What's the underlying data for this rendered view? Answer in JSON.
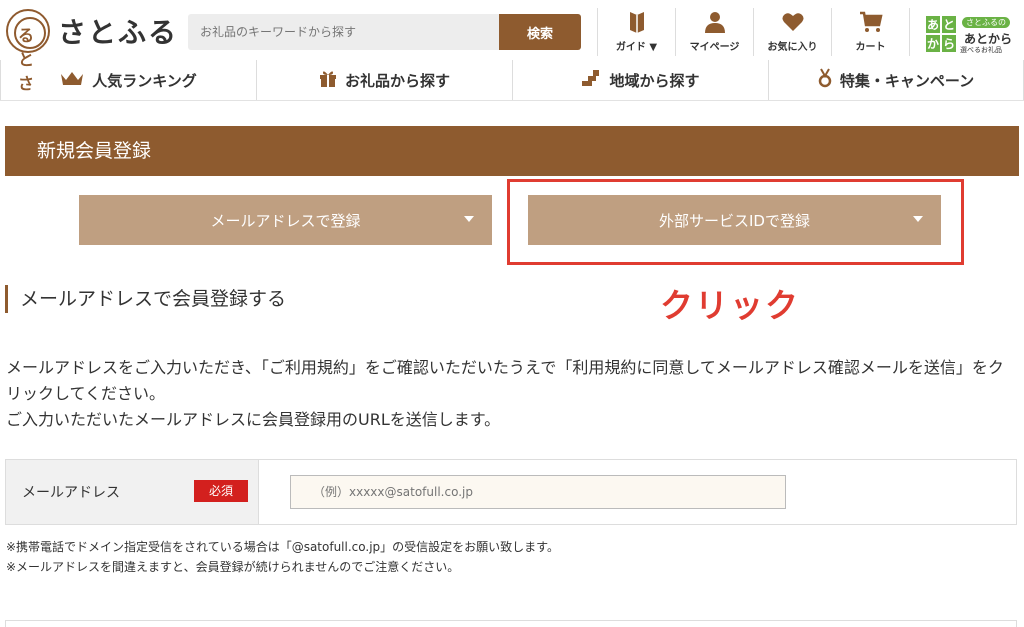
{
  "header": {
    "logo_mark": "るとさ",
    "logo_text": "さとふる",
    "search_placeholder": "お礼品のキーワードから探す",
    "search_button": "検索",
    "util": [
      {
        "label": "ガイド ▼",
        "icon": "book-icon"
      },
      {
        "label": "マイページ",
        "icon": "user-icon"
      },
      {
        "label": "お気に入り",
        "icon": "heart-icon"
      },
      {
        "label": "カート",
        "icon": "cart-icon"
      }
    ],
    "atokara": {
      "grid": [
        "あ",
        "と",
        "か",
        "ら"
      ],
      "badge": "さとふるの",
      "title": "あとから",
      "sub": "選べるお礼品"
    }
  },
  "nav": [
    {
      "label": "人気ランキング",
      "icon": "crown-icon"
    },
    {
      "label": "お礼品から探す",
      "icon": "gift-icon"
    },
    {
      "label": "地域から探す",
      "icon": "map-icon"
    },
    {
      "label": "特集・キャンペーン",
      "icon": "medal-icon"
    }
  ],
  "page_title": "新規会員登録",
  "tabs": {
    "email": "メールアドレスで登録",
    "external": "外部サービスIDで登録"
  },
  "annotation": "クリック",
  "section_heading": "メールアドレスで会員登録する",
  "description": [
    "メールアドレスをご入力いただき、「ご利用規約」をご確認いただいたうえで「利用規約に同意してメールアドレス確認メールを送信」をクリックしてください。",
    "ご入力いただいたメールアドレスに会員登録用のURLを送信します。"
  ],
  "form": {
    "email_label": "メールアドレス",
    "required_badge": "必須",
    "email_placeholder": "（例）xxxxx@satofull.co.jp"
  },
  "notes": [
    "※携帯電話でドメイン指定受信をされている場合は「@satofull.co.jp」の受信設定をお願い致します。",
    "※メールアドレスを間違えますと、会員登録が続けられませんのでご注意ください。"
  ],
  "colors": {
    "brand_brown": "#8e5b2f",
    "tab_tan": "#bf9f81",
    "highlight_red": "#e03c31",
    "required_red": "#d3201e",
    "atokara_green": "#6ab245"
  }
}
